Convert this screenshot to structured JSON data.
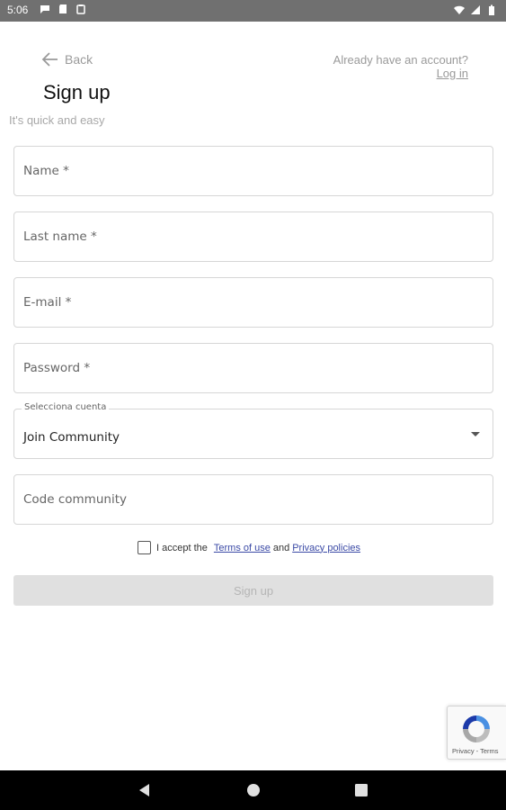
{
  "status_bar": {
    "time": "5:06",
    "left_icons": [
      "chat-bubble-icon",
      "sd-card-icon",
      "clipboard-icon"
    ],
    "right_icons": [
      "wifi-icon",
      "cell-signal-icon",
      "battery-icon"
    ]
  },
  "header": {
    "back_label": "Back",
    "account_prompt": "Already have an account?",
    "login_label": "Log in",
    "title": "Sign up",
    "subtitle": "It's quick and easy"
  },
  "form": {
    "name_placeholder": "Name *",
    "last_name_placeholder": "Last name *",
    "email_placeholder": "E-mail *",
    "password_placeholder": "Password *",
    "account_select": {
      "label": "Selecciona cuenta",
      "value": "Join Community"
    },
    "code_placeholder": "Code community",
    "terms": {
      "prefix": "I accept the",
      "terms_link": "Terms of use",
      "conjunction": "and",
      "privacy_link": "Privacy policies",
      "checked": false
    },
    "submit_label": "Sign up"
  },
  "recaptcha": {
    "text": "Privacy - Terms"
  },
  "colors": {
    "status_bar": "#707070",
    "link": "#3b4aa6",
    "muted_text": "#9a9a9a",
    "disabled_button": "#e0e0e0",
    "nav_bar": "#000000"
  }
}
